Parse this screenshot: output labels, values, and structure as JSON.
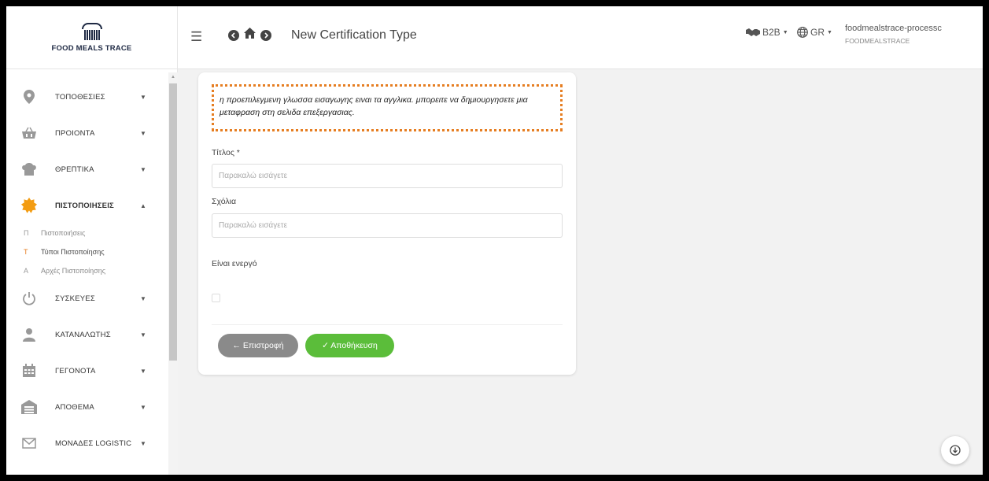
{
  "app": {
    "logo_text": "FOOD MEALS TRACE"
  },
  "header": {
    "title": "New Certification Type",
    "b2b_label": "B2B",
    "lang_label": "GR",
    "username": "foodmealstrace-processc",
    "organization": "FOODMEALSTRACE"
  },
  "sidebar": {
    "items": [
      {
        "label": "ΤΟΠΟΘΕΣΙΕΣ",
        "icon": "location-pin-icon"
      },
      {
        "label": "ΠΡΟΙΟΝΤΑ",
        "icon": "basket-icon"
      },
      {
        "label": "ΘΡΕΠΤΙΚΑ",
        "icon": "chef-hat-icon"
      },
      {
        "label": "ΠΙΣΤΟΠΟΙΗΣΕΙΣ",
        "icon": "certificate-badge-icon",
        "active": true
      },
      {
        "label": "ΣΥΣΚΕΥΕΣ",
        "icon": "power-icon"
      },
      {
        "label": "ΚΑΤΑΝΑΛΩΤΗΣ",
        "icon": "user-icon"
      },
      {
        "label": "ΓΕΓΟΝΟΤΑ",
        "icon": "calendar-icon"
      },
      {
        "label": "ΑΠΟΘΕΜΑ",
        "icon": "warehouse-icon"
      },
      {
        "label": "ΜΟΝΑΔΕΣ LOGISTIC",
        "icon": "envelope-icon"
      }
    ],
    "subitems": [
      {
        "letter": "Π",
        "label": "Πιστοποιήσεις"
      },
      {
        "letter": "Τ",
        "label": "Τύποι Πιστοποίησης",
        "current": true
      },
      {
        "letter": "Α",
        "label": "Αρχές Πιστοποίησης"
      }
    ]
  },
  "form": {
    "notice": "η προεπιλεγμενη γλωσσα εισαγωγης ειναι τα αγγλικα. μπορειτε να δημιουργησετε μια μεταφραση στη σελιδα επεξεργασιας.",
    "title_label": "Τίτλος *",
    "title_placeholder": "Παρακαλώ εισάγετε",
    "title_value": "",
    "comments_label": "Σχόλια",
    "comments_placeholder": "Παρακαλώ εισάγετε",
    "comments_value": "",
    "active_label": "Είναι ενεργό",
    "active_checked": false,
    "back_label": "← Επιστροφή",
    "save_label": "✓ Αποθήκευση"
  },
  "colors": {
    "accent_orange": "#e67e22",
    "save_green": "#5bbd3a",
    "back_gray": "#8a8a8a",
    "brand_navy": "#1f2a44"
  }
}
